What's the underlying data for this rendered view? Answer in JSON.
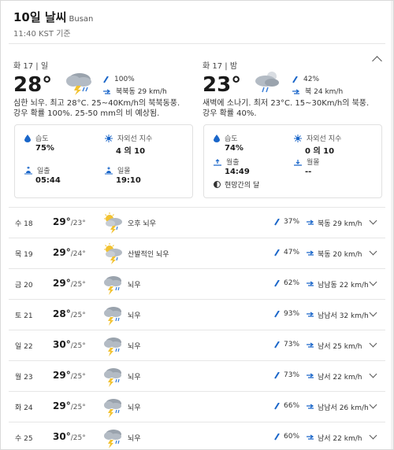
{
  "header": {
    "title": "10일 날씨",
    "location": "Busan",
    "updated": "11:40 KST 기준"
  },
  "colors": {
    "accent": "#1a66c9",
    "divider": "#e6e6e6"
  },
  "current": {
    "day": {
      "label": "화 17 | 일",
      "temp": "28°",
      "precip": "100%",
      "wind": "북북동 29 km/h",
      "desc": "심한 뇌우. 최고 28°C. 25~40Km/h의 북북동풍. 강우 확률 100%. 25-50 mm의 비 예상됨.",
      "humidity_label": "습도",
      "humidity": "75%",
      "uv_label": "자외선 지수",
      "uv": "4 의 10",
      "sunrise_label": "일출",
      "sunrise": "05:44",
      "sunset_label": "일몰",
      "sunset": "19:10"
    },
    "night": {
      "label": "화 17 | 밤",
      "temp": "23°",
      "precip": "42%",
      "wind": "북 24 km/h",
      "desc": "새벽에 소나기. 최저 23°C. 15~30Km/h의 북풍. 강우 확률 40%.",
      "humidity_label": "습도",
      "humidity": "74%",
      "uv_label": "자외선 지수",
      "uv": "0 의 10",
      "moonrise_label": "월출",
      "moonrise": "14:49",
      "moonset_label": "월몰",
      "moonset": "--",
      "moon_phase": "현망간의 달"
    }
  },
  "forecast": [
    {
      "day": "수 18",
      "hi": "29°",
      "lo": "/23°",
      "icon": "partly-cloudy-thunder-icon",
      "cond": "오후 뇌우",
      "precip": "37%",
      "wind": "북동 29 km/h"
    },
    {
      "day": "목 19",
      "hi": "29°",
      "lo": "/24°",
      "icon": "partly-cloudy-thunder-icon",
      "cond": "산발적인 뇌우",
      "precip": "47%",
      "wind": "북동 20 km/h"
    },
    {
      "day": "금 20",
      "hi": "29°",
      "lo": "/25°",
      "icon": "thunderstorm-icon",
      "cond": "뇌우",
      "precip": "62%",
      "wind": "남남동 22 km/h"
    },
    {
      "day": "토 21",
      "hi": "28°",
      "lo": "/25°",
      "icon": "thunderstorm-icon",
      "cond": "뇌우",
      "precip": "93%",
      "wind": "남남서 32 km/h"
    },
    {
      "day": "일 22",
      "hi": "30°",
      "lo": "/25°",
      "icon": "thunderstorm-icon",
      "cond": "뇌우",
      "precip": "73%",
      "wind": "남서 25 km/h"
    },
    {
      "day": "월 23",
      "hi": "29°",
      "lo": "/25°",
      "icon": "thunderstorm-icon",
      "cond": "뇌우",
      "precip": "73%",
      "wind": "남서 22 km/h"
    },
    {
      "day": "화 24",
      "hi": "29°",
      "lo": "/25°",
      "icon": "thunderstorm-icon",
      "cond": "뇌우",
      "precip": "66%",
      "wind": "남남서 26 km/h"
    },
    {
      "day": "수 25",
      "hi": "30°",
      "lo": "/25°",
      "icon": "thunderstorm-icon",
      "cond": "뇌우",
      "precip": "60%",
      "wind": "남서 22 km/h"
    }
  ]
}
